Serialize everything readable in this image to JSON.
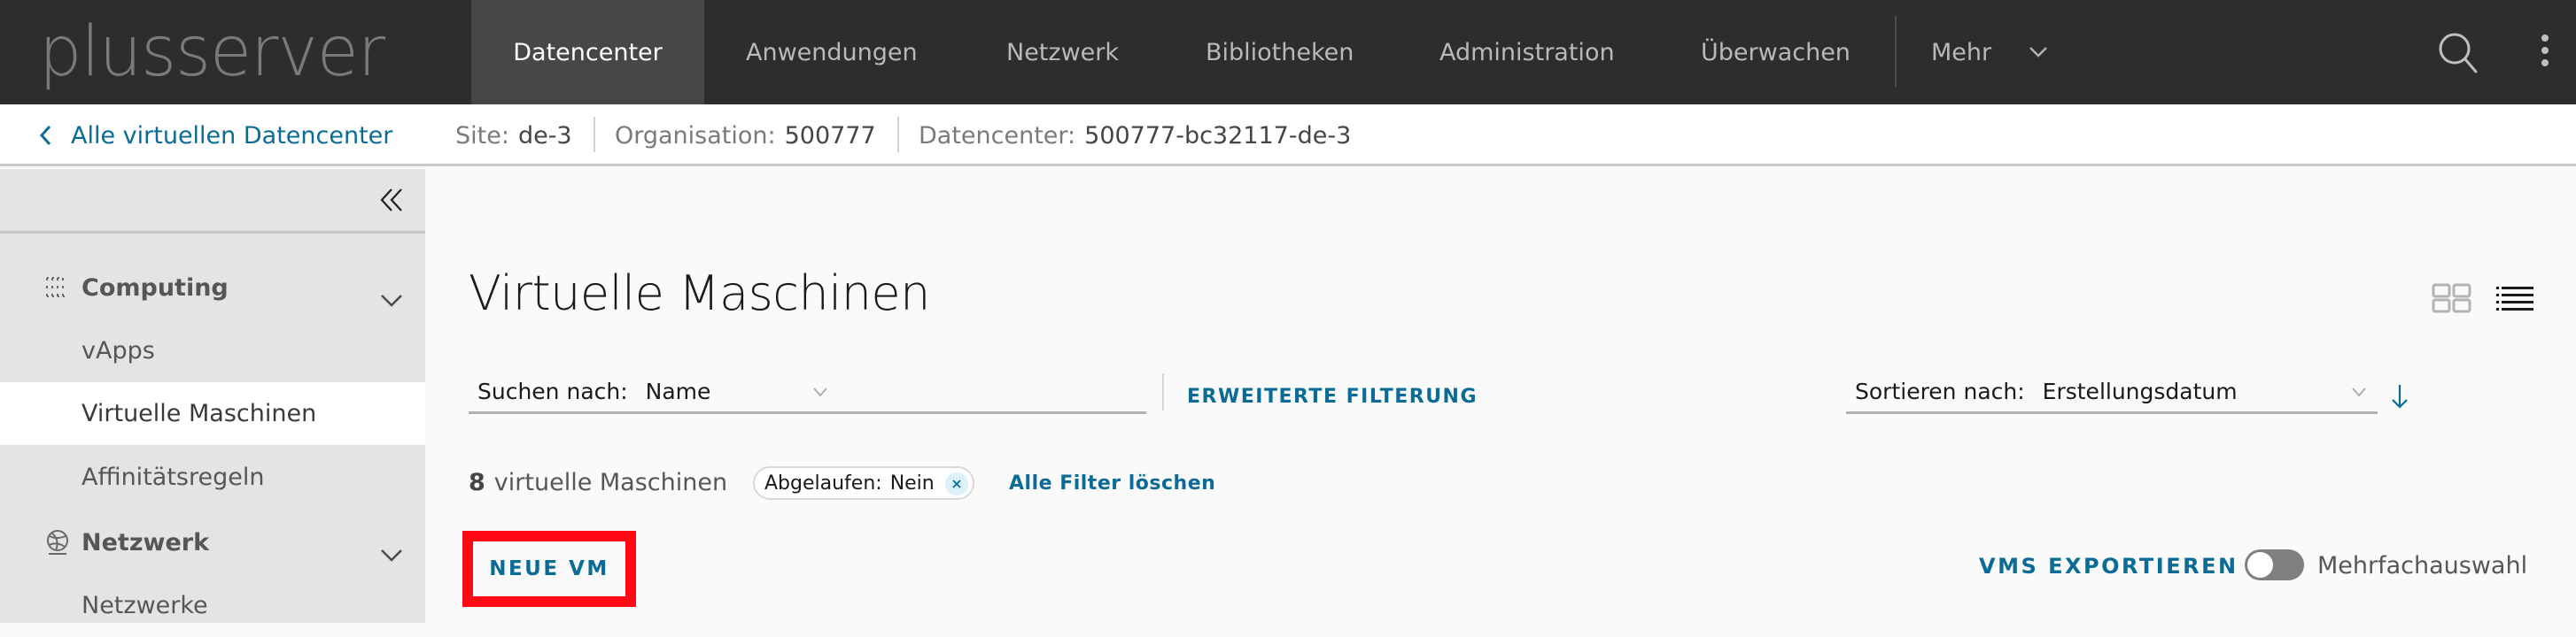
{
  "header": {
    "logo_text": "plusserver",
    "nav": [
      {
        "label": "Datencenter",
        "active": true
      },
      {
        "label": "Anwendungen",
        "active": false
      },
      {
        "label": "Netzwerk",
        "active": false
      },
      {
        "label": "Bibliotheken",
        "active": false
      },
      {
        "label": "Administration",
        "active": false
      },
      {
        "label": "Überwachen",
        "active": false
      }
    ],
    "more_label": "Mehr",
    "icons": [
      "search-icon",
      "more-vertical-icon",
      "chevron-down-icon"
    ]
  },
  "breadcrumb": {
    "back_label": "Alle virtuellen Datencenter",
    "items": [
      {
        "label": "Site:",
        "value": "de-3"
      },
      {
        "label": "Organisation:",
        "value": "500777"
      },
      {
        "label": "Datencenter:",
        "value": "500777-bc32117-de-3"
      }
    ]
  },
  "sidebar": {
    "collapse_icon": "double-chevron-left-icon",
    "groups": [
      {
        "label": "Computing",
        "icon": "computing-grid-icon",
        "expanded": true,
        "items": [
          {
            "label": "vApps",
            "selected": false
          },
          {
            "label": "Virtuelle Maschinen",
            "selected": true
          },
          {
            "label": "Affinitätsregeln",
            "selected": false
          }
        ]
      },
      {
        "label": "Netzwerk",
        "icon": "network-globe-icon",
        "expanded": true,
        "items": [
          {
            "label": "Netzwerke",
            "selected": false
          }
        ]
      }
    ]
  },
  "main": {
    "title": "Virtuelle Maschinen",
    "view_modes": [
      {
        "name": "grid-view",
        "active": false
      },
      {
        "name": "list-view",
        "active": true
      }
    ],
    "search": {
      "label": "Suchen nach:",
      "value": "Name"
    },
    "advanced_filter_label": "ERWEITERTE FILTERUNG",
    "sort": {
      "label": "Sortieren nach:",
      "value": "Erstellungsdatum",
      "direction": "descending"
    },
    "count": {
      "number": "8",
      "text": "virtuelle Maschinen"
    },
    "filter_chips": [
      {
        "label": "Abgelaufen:",
        "value": "Nein"
      }
    ],
    "clear_filters_label": "Alle Filter löschen",
    "new_vm_label": "NEUE VM",
    "export_label": "VMS EXPORTIEREN",
    "multi_select": {
      "label": "Mehrfachauswahl",
      "enabled": false
    }
  },
  "colors": {
    "header_bg": "#2d2d2d",
    "active_tab_bg": "#474747",
    "link_blue": "#0a6b96",
    "sidebar_bg": "#e4e4e4",
    "highlight_red": "#ff0a14"
  }
}
